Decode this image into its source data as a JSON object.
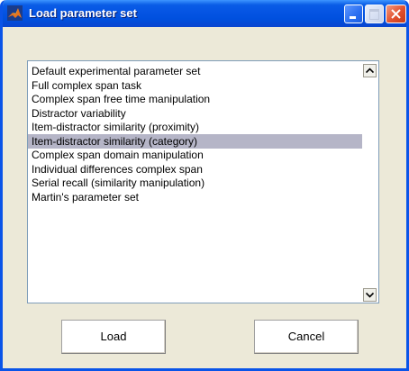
{
  "window": {
    "title": "Load parameter set",
    "icon": "matlab-icon"
  },
  "titlebar_buttons": {
    "minimize": "minimize-icon",
    "maximize": "maximize-icon",
    "close": "close-icon"
  },
  "list": {
    "items": [
      "Default experimental parameter set",
      "Full complex span task",
      "Complex span free time manipulation",
      "Distractor variability",
      "Item-distractor similarity (proximity)",
      "Item-distractor similarity (category)",
      "Complex span domain manipulation",
      "Individual differences complex span",
      "Serial recall (similarity manipulation)",
      "Martin's parameter set"
    ],
    "selected_index": 5
  },
  "buttons": {
    "load": "Load",
    "cancel": "Cancel"
  },
  "colors": {
    "titlebar": "#0554e3",
    "window_bg": "#ece9d8",
    "selection": "#b5b5c7"
  }
}
